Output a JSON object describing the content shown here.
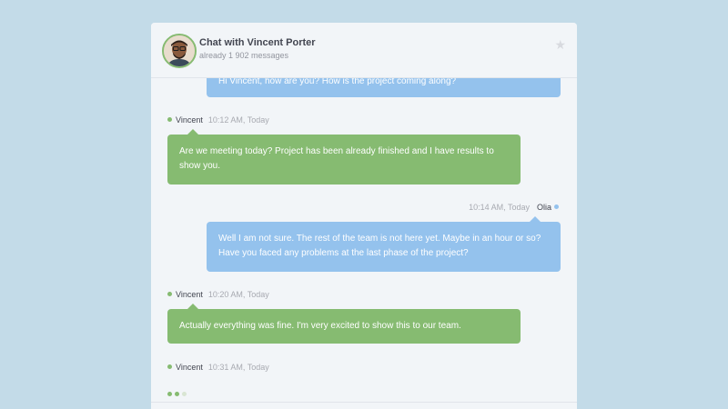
{
  "header": {
    "title": "Chat with Vincent Porter",
    "subtitle": "already 1 902 messages",
    "favorite_icon": "star-icon"
  },
  "messages": [
    {
      "sender": "Olia",
      "side": "right",
      "time": "",
      "text": "Hi Vincent, how are you? How is the project coming along?",
      "color": "#94c2ed"
    },
    {
      "sender": "Vincent",
      "side": "left",
      "time": "10:12 AM, Today",
      "text": "Are we meeting today? Project has been already finished and I have results to show you.",
      "color": "#86bb71"
    },
    {
      "sender": "Olia",
      "side": "right",
      "time": "10:14 AM, Today",
      "text": "Well I am not sure. The rest of the team is not here yet. Maybe in an hour or so? Have you faced any problems at the last phase of the project?",
      "color": "#94c2ed"
    },
    {
      "sender": "Vincent",
      "side": "left",
      "time": "10:20 AM, Today",
      "text": "Actually everything was fine. I'm very excited to show this to our team.",
      "color": "#86bb71"
    },
    {
      "sender": "Vincent",
      "side": "left",
      "time": "10:31 AM, Today",
      "text": "",
      "color": "#86bb71"
    }
  ],
  "typing_indicator": {
    "dot_colors": [
      "#86bb71",
      "#86bb71",
      "#d9e5d3"
    ]
  },
  "colors": {
    "background": "#c3dbe8",
    "panel": "#f2f5f8",
    "green": "#86bb71",
    "blue": "#94c2ed"
  }
}
